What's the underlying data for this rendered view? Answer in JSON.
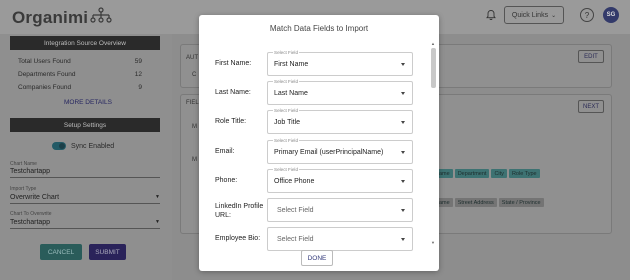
{
  "header": {
    "logo": "Organimi",
    "quick_links": "Quick Links",
    "help": "?",
    "avatar": "SG"
  },
  "sidebar": {
    "integration_title": "Integration Source Overview",
    "stats": [
      {
        "label": "Total Users Found",
        "value": "59"
      },
      {
        "label": "Departments Found",
        "value": "12"
      },
      {
        "label": "Companies Found",
        "value": "9"
      }
    ],
    "more_details": "MORE DETAILS",
    "setup_title": "Setup Settings",
    "sync_label": "Sync Enabled",
    "chart_name_caption": "Chart Name",
    "chart_name_value": "Testchartapp",
    "import_type_caption": "Import Type",
    "import_type_value": "Overwrite Chart",
    "chart_overwrite_caption": "Chart To Overwrite",
    "chart_overwrite_value": "Testchartapp",
    "cancel": "CANCEL",
    "submit": "SUBMIT"
  },
  "main": {
    "auth_label": "AUT",
    "auth_sub": "C",
    "edit": "EDIT",
    "fields_label": "FIEL",
    "fields_sub1": "M",
    "fields_sub2": "M",
    "next": "NEXT",
    "chips_row1": [
      "ame",
      "Department",
      "City",
      "Role Type"
    ],
    "chips_row2": [
      "ame",
      "Street Address",
      "State / Province"
    ]
  },
  "modal": {
    "title": "Match Data Fields to Import",
    "select_caption": "Select Field",
    "placeholder": "Select Field",
    "fields": [
      {
        "label": "First Name:",
        "value": "First Name"
      },
      {
        "label": "Last Name:",
        "value": "Last Name"
      },
      {
        "label": "Role Title:",
        "value": "Job Title"
      },
      {
        "label": "Email:",
        "value": "Primary Email (userPrincipalName)"
      },
      {
        "label": "Phone:",
        "value": "Office Phone"
      },
      {
        "label": "LinkedIn Profile URL:",
        "value": ""
      },
      {
        "label": "Employee Bio:",
        "value": ""
      }
    ],
    "done": "DONE"
  },
  "colors": {
    "accent_teal": "#2a5c5a",
    "accent_navy": "#2a235a",
    "chip_teal": "#3d7272"
  }
}
